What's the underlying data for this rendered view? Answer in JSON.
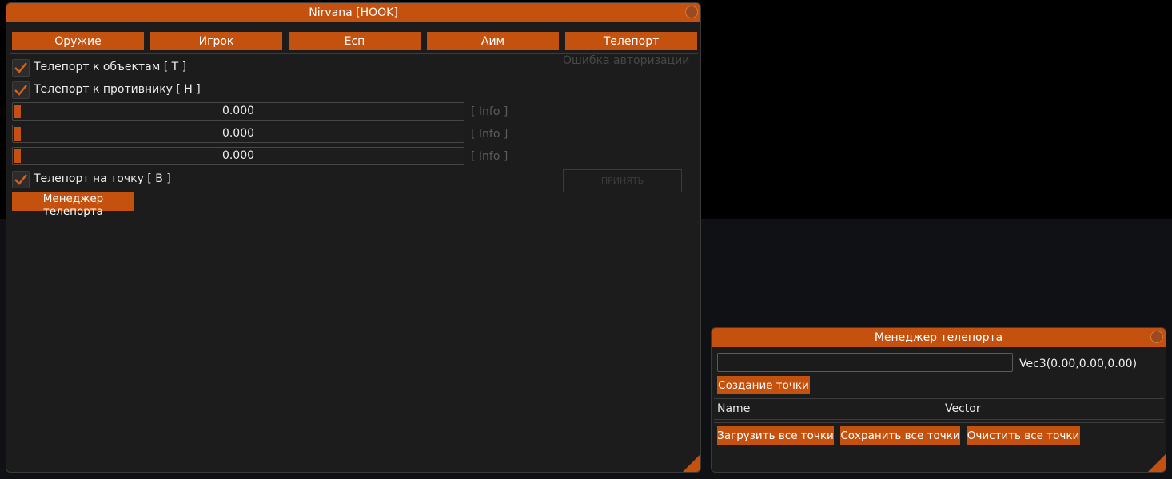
{
  "main_window": {
    "title": "Nirvana [HOOK]",
    "tabs": [
      {
        "label": "Оружие"
      },
      {
        "label": "Игрок"
      },
      {
        "label": "Есп"
      },
      {
        "label": "Аим"
      },
      {
        "label": "Телепорт"
      }
    ],
    "options": [
      {
        "label": "Телепорт к объектам [ T ]",
        "checked": true
      },
      {
        "label": "Телепорт к противнику [ H ]",
        "checked": true
      },
      {
        "label": "Телепорт на точку [ B ]",
        "checked": true
      }
    ],
    "sliders": [
      {
        "value": "0.000",
        "info": "[ Info ]"
      },
      {
        "value": "0.000",
        "info": "[ Info ]"
      },
      {
        "value": "0.000",
        "info": "[ Info ]"
      }
    ],
    "manager_button": "Менеджер телепорта",
    "auth_error": "Ошибка авторизации",
    "accept_button": "ПРИНЯТЬ"
  },
  "teleport_manager": {
    "title": "Менеджер телепорта",
    "name_input": {
      "value": "",
      "placeholder": ""
    },
    "vec_label": "Vec3(0.00,0.00,0.00)",
    "create_button": "Создание точки",
    "columns": [
      "Name",
      "Vector"
    ],
    "buttons": {
      "load_all": "Загрузить все точки",
      "save_all": "Сохранить все точки",
      "clear_all": "Очистить все точки"
    }
  },
  "colors": {
    "accent": "#c4510e",
    "window_bg": "#1c1c1c",
    "desktop_bottom": "#0f1115"
  }
}
